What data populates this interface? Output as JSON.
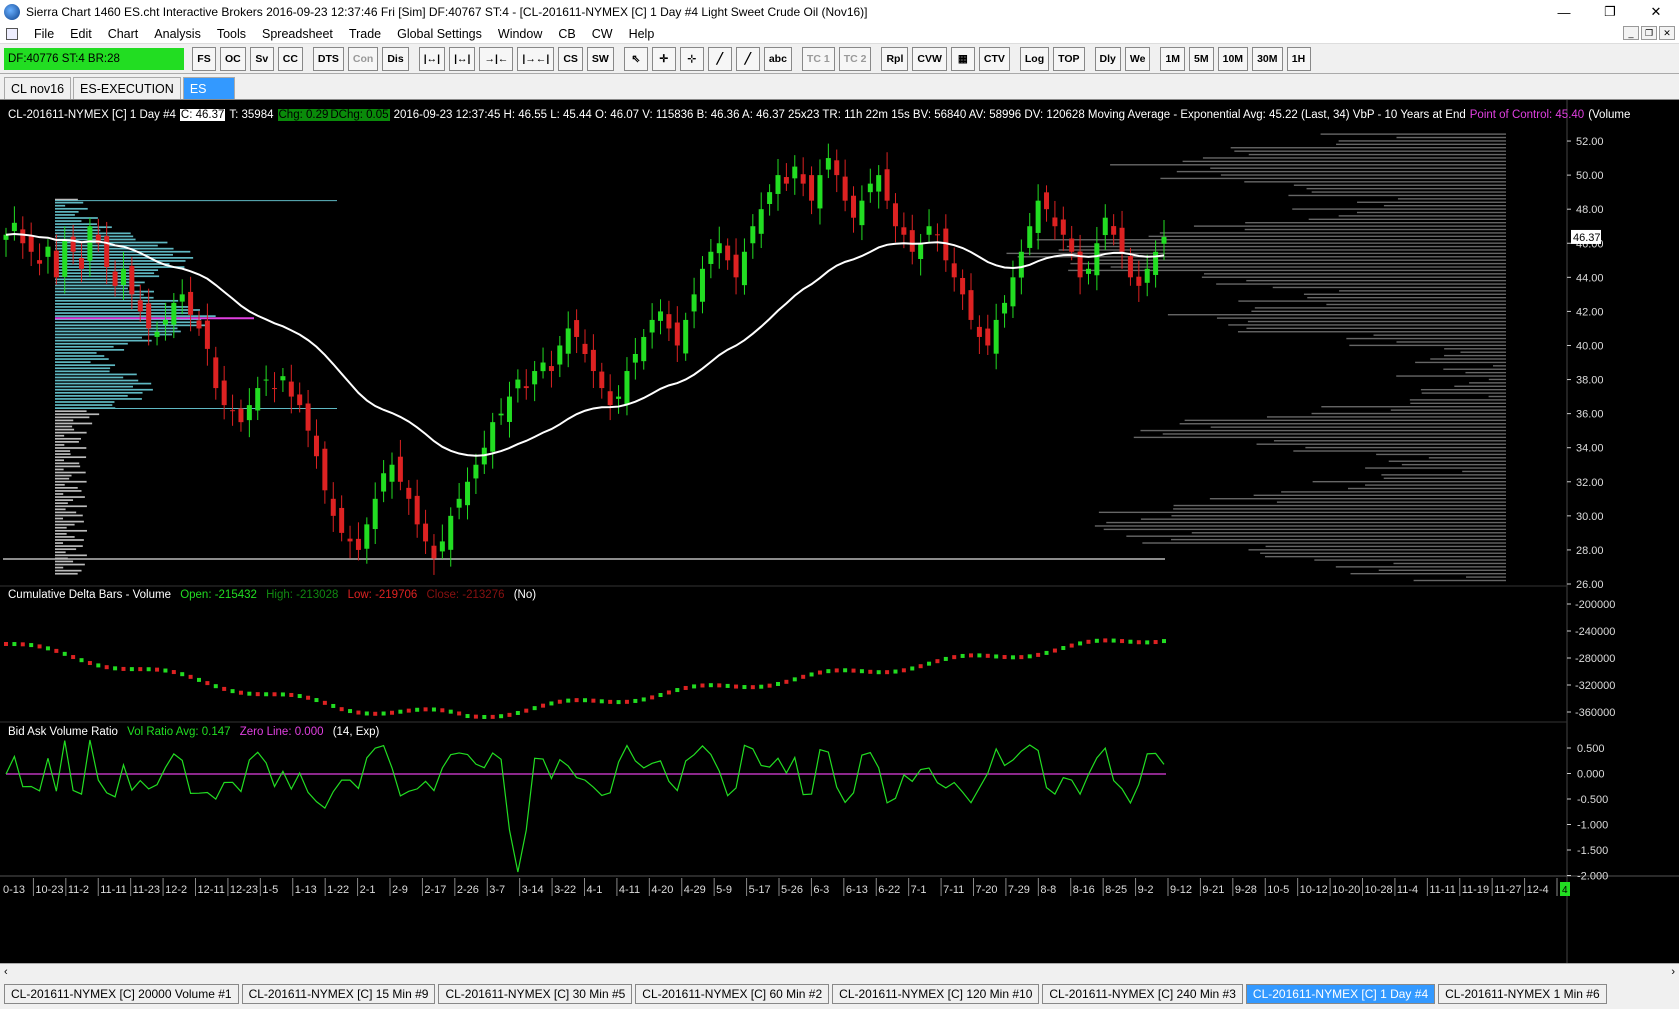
{
  "window": {
    "title": "Sierra Chart 1460 ES.cht  Interactive Brokers 2016-09-23  12:37:46 Fri [Sim]  DF:40767  ST:4 - [CL-201611-NYMEX [C]  1 Day   #4  Light Sweet Crude Oil (Nov16)]",
    "minimize": "—",
    "maximize": "❐",
    "close": "✕"
  },
  "menu": [
    "File",
    "Edit",
    "Chart",
    "Analysis",
    "Tools",
    "Spreadsheet",
    "Trade",
    "Global Settings",
    "Window",
    "CB",
    "CW",
    "Help"
  ],
  "toolbar": {
    "status": "DF:40776  ST:4  BR:28",
    "buttons": [
      "FS",
      "OC",
      "Sv",
      "CC",
      "DTS",
      "Con",
      "Dis",
      "|↔|",
      "|↔|",
      "→|←",
      "|→←|",
      "CS",
      "SW",
      "⇖",
      "✛",
      "⊹",
      "╱",
      "╱",
      "abc",
      "TC 1",
      "TC 2",
      "Rpl",
      "CVW",
      "▦",
      "CTV",
      "Log",
      "TOP",
      "Dly",
      "We",
      "1M",
      "5M",
      "10M",
      "30M",
      "1H"
    ],
    "disabled": [
      "Con",
      "TC 1",
      "TC 2"
    ]
  },
  "chartbook_tabs": [
    "CL nov16",
    "ES-EXECUTION",
    "ES"
  ],
  "header": {
    "symbol": "CL-201611-NYMEX [C]  1 Day   #4",
    "close": "C: 46.37",
    "trades": "T: 35984",
    "chg": "Chg: 0.29",
    "dchg": "DChg: 0.05",
    "rest": "2016-09-23 12:37:45  H: 46.55  L: 45.44  O: 46.07  V: 115836  B: 46.36  A: 46.37  25x23  TR: 11h 22m 15s  BV: 56840  AV: 58996  DV: 120628  Moving Average - Exponential  Avg: 45.22  (Last, 34)  VbP - 10 Years at End",
    "poc": "Point of Control: 45.40",
    "tail": "(Volume"
  },
  "cum_delta_header": {
    "name": "Cumulative Delta Bars - Volume",
    "open": "Open: -215432",
    "high": "High: -213028",
    "low": "Low: -219706",
    "close": "Close: -213276",
    "flag": "(No)"
  },
  "ratio_header": {
    "name": "Bid Ask Volume Ratio",
    "avg": "Vol Ratio Avg: 0.147",
    "zero": "Zero Line: 0.000",
    "params": "(14, Exp)"
  },
  "price_axis": [
    "52.00",
    "50.00",
    "48.00",
    "46.00",
    "44.00",
    "42.00",
    "40.00",
    "38.00",
    "36.00",
    "34.00",
    "32.00",
    "30.00",
    "28.00",
    "26.00"
  ],
  "last_price_label": "46.37",
  "cum_axis": [
    "-200000",
    "-240000",
    "-280000",
    "-320000",
    "-360000"
  ],
  "ratio_axis": [
    "0.500",
    "0.000",
    "-0.500",
    "-1.000",
    "-1.500",
    "-2.000"
  ],
  "date_axis": [
    "0-13",
    "10-23",
    "11-2",
    "11-11",
    "11-23",
    "12-2",
    "12-11",
    "12-23",
    "1-5",
    "1-13",
    "1-22",
    "2-1",
    "2-9",
    "2-17",
    "2-26",
    "3-7",
    "3-14",
    "3-22",
    "4-1",
    "4-11",
    "4-20",
    "4-29",
    "5-9",
    "5-17",
    "5-26",
    "6-3",
    "6-13",
    "6-22",
    "7-1",
    "7-11",
    "7-20",
    "7-29",
    "8-8",
    "8-16",
    "8-25",
    "9-2",
    "9-12",
    "9-21",
    "9-28",
    "10-5",
    "10-12",
    "10-20",
    "10-28",
    "11-4",
    "11-11",
    "11-19",
    "11-27",
    "12-4"
  ],
  "date_axis_badge": "4",
  "chart_tabs": [
    "CL-201611-NYMEX [C]  20000 Volume  #1",
    "CL-201611-NYMEX [C]  15 Min  #9",
    "CL-201611-NYMEX [C]  30 Min  #5",
    "CL-201611-NYMEX [C]  60 Min  #2",
    "CL-201611-NYMEX [C]  120 Min  #10",
    "CL-201611-NYMEX [C]  240 Min  #3",
    "CL-201611-NYMEX [C]  1 Day  #4",
    "CL-201611-NYMEX  1 Min  #6"
  ],
  "active_chart_tab": 6,
  "colors": {
    "up": "#22dd22",
    "down": "#dd2222",
    "vbp_fill": "#5fb8c2",
    "vbp_gray": "#bbbbbb",
    "ma": "#ffffff",
    "poc": "#e040e0",
    "ratio_line": "#22dd22"
  },
  "chart_data": {
    "type": "candlestick",
    "symbol": "CL-201611-NYMEX [C]",
    "ylim": [
      26,
      53
    ],
    "closes": [
      46.5,
      47.2,
      46.0,
      45.5,
      44.8,
      45.8,
      44.0,
      46.2,
      45.5,
      44.5,
      47.0,
      46.0,
      44.6,
      43.5,
      44.5,
      43.0,
      42.0,
      41.0,
      40.8,
      41.5,
      42.5,
      43.0,
      41.8,
      41.0,
      39.8,
      37.5,
      36.5,
      36.2,
      35.5,
      36.5,
      37.5,
      38.0,
      37.5,
      38.2,
      37.0,
      36.5,
      35.0,
      33.5,
      31.5,
      30.0,
      29.0,
      28.5,
      28.0,
      29.5,
      31.0,
      32.5,
      33.0,
      32.0,
      31.0,
      29.5,
      28.5,
      27.5,
      28.5,
      30.0,
      31.0,
      32.0,
      33.0,
      34.0,
      35.5,
      36.0,
      37.0,
      38.0,
      37.5,
      38.5,
      39.0,
      38.5,
      40.0,
      41.0,
      40.5,
      39.5,
      38.5,
      37.5,
      36.5,
      37.0,
      38.5,
      39.5,
      40.5,
      41.5,
      42.0,
      41.0,
      40.0,
      41.5,
      43.0,
      44.5,
      45.5,
      46.0,
      45.0,
      44.0,
      45.5,
      47.0,
      48.0,
      49.0,
      50.0,
      49.5,
      50.5,
      49.5,
      48.5,
      50.0,
      51.0,
      50.0,
      48.5,
      47.5,
      48.5,
      49.5,
      50.0,
      48.5,
      47.0,
      46.5,
      45.5,
      46.0,
      47.0,
      46.5,
      45.0,
      44.0,
      43.0,
      41.5,
      40.5,
      40.0,
      41.5,
      42.5,
      44.0,
      45.5,
      47.0,
      48.5,
      48.0,
      47.0,
      46.5,
      45.5,
      44.0,
      44.5,
      46.0,
      47.5,
      46.5,
      45.5,
      44.0,
      43.5,
      44.5,
      45.5,
      46.37
    ],
    "moving_average": {
      "name": "Moving Average - Exponential",
      "length": 34,
      "last": 45.22
    },
    "point_of_control": 45.4
  }
}
